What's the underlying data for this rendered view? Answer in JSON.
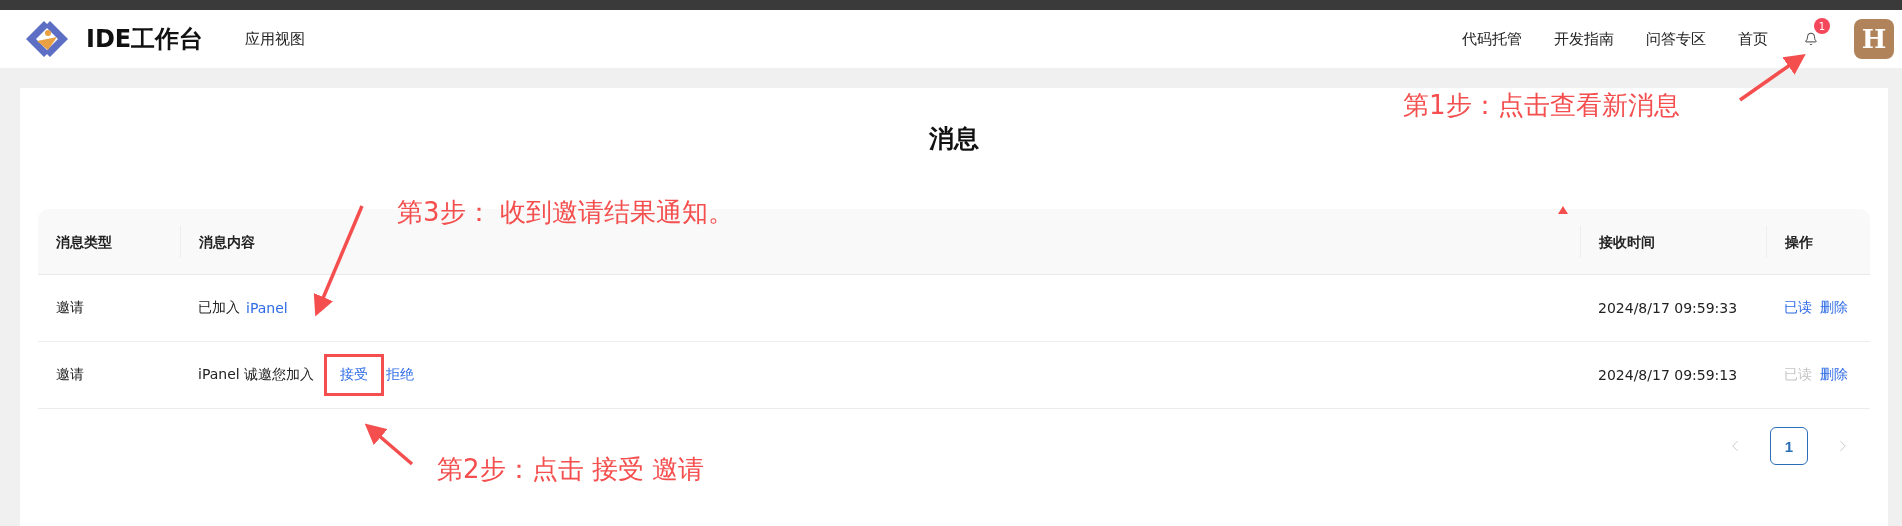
{
  "header": {
    "title": "IDE工作台",
    "nav_left": [
      "应用视图"
    ],
    "nav_right": [
      "代码托管",
      "开发指南",
      "问答专区",
      "首页"
    ],
    "notification_count": "1",
    "avatar_letter": "H"
  },
  "page_title": "消息",
  "table": {
    "columns": [
      "消息类型",
      "消息内容",
      "接收时间",
      "操作"
    ],
    "rows": [
      {
        "type": "邀请",
        "content": [
          {
            "kind": "text",
            "text": "已加入"
          },
          {
            "kind": "link",
            "text": "iPanel",
            "boxed": false
          }
        ],
        "time": "2024/8/17 09:59:33",
        "actions": [
          {
            "label": "已读",
            "disabled": false
          },
          {
            "label": "删除",
            "disabled": false
          }
        ]
      },
      {
        "type": "邀请",
        "content": [
          {
            "kind": "text",
            "text": "iPanel 诚邀您加入"
          },
          {
            "kind": "link",
            "text": "接受",
            "boxed": true
          },
          {
            "kind": "link",
            "text": "拒绝",
            "boxed": false
          }
        ],
        "time": "2024/8/17 09:59:13",
        "actions": [
          {
            "label": "已读",
            "disabled": true
          },
          {
            "label": "删除",
            "disabled": false
          }
        ]
      }
    ]
  },
  "pagination": {
    "prev_disabled": true,
    "next_disabled": true,
    "pages": [
      {
        "label": "1",
        "selected": true
      }
    ]
  },
  "annotations": [
    "第1步：点击查看新消息",
    "第3步： 收到邀请结果通知。",
    "第2步：点击 接受 邀请"
  ]
}
